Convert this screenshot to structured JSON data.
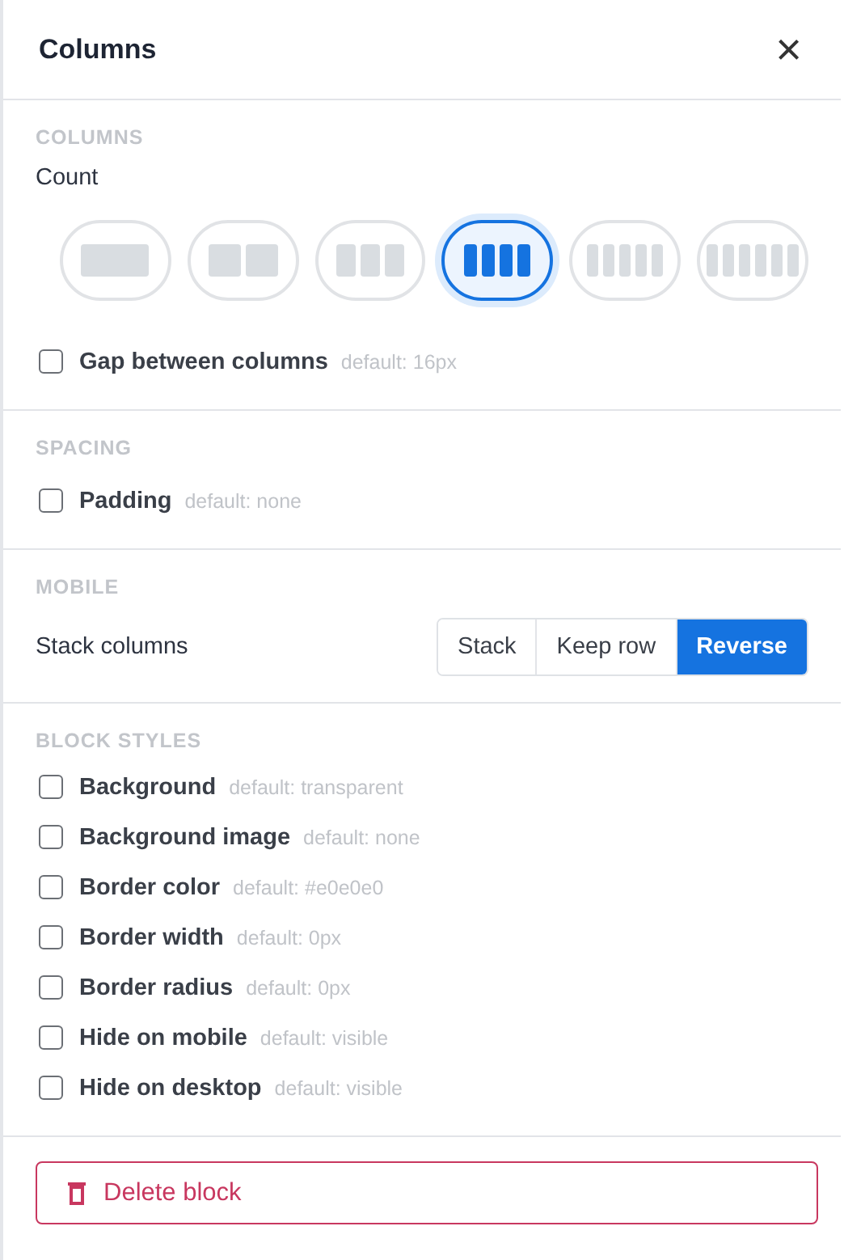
{
  "panel": {
    "title": "Columns",
    "close": "×"
  },
  "columns_section": {
    "heading": "COLUMNS",
    "count_label": "Count",
    "count_options": [
      {
        "selected": false
      },
      {
        "selected": false
      },
      {
        "selected": false
      },
      {
        "selected": true
      },
      {
        "selected": false
      },
      {
        "selected": false
      }
    ],
    "options": [
      {
        "label": "Gap between columns",
        "hint": "default: 16px",
        "checked": false
      }
    ]
  },
  "spacing_section": {
    "heading": "SPACING",
    "options": [
      {
        "label": "Padding",
        "hint": "default: none",
        "checked": false
      }
    ]
  },
  "mobile_section": {
    "heading": "MOBILE",
    "label": "Stack columns",
    "choices": [
      {
        "label": "Stack",
        "selected": false
      },
      {
        "label": "Keep row",
        "selected": false
      },
      {
        "label": "Reverse",
        "selected": true
      }
    ]
  },
  "block_styles_section": {
    "heading": "BLOCK STYLES",
    "options": [
      {
        "label": "Background",
        "hint": "default: transparent",
        "checked": false
      },
      {
        "label": "Background image",
        "hint": "default: none",
        "checked": false
      },
      {
        "label": "Border color",
        "hint": "default: #e0e0e0",
        "checked": false
      },
      {
        "label": "Border width",
        "hint": "default: 0px",
        "checked": false
      },
      {
        "label": "Border radius",
        "hint": "default: 0px",
        "checked": false
      },
      {
        "label": "Hide on mobile",
        "hint": "default: visible",
        "checked": false
      },
      {
        "label": "Hide on desktop",
        "hint": "default: visible",
        "checked": false
      }
    ]
  },
  "delete_button": {
    "label": "Delete block"
  }
}
